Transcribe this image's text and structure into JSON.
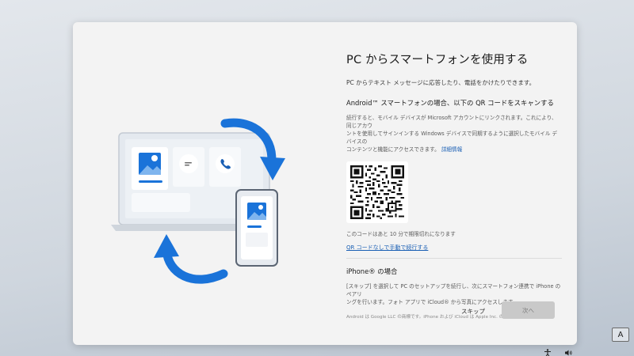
{
  "oobe": {
    "title": "PC からスマートフォンを使用する",
    "subtitle": "PC からテキスト メッセージに応答したり、電話をかけたりできます。",
    "android": {
      "heading": "Android™ スマートフォンの場合、以下の QR コードをスキャンする",
      "desc_line1": "続行すると、モバイル デバイスが Microsoft アカウントにリンクされます。これにより、同じアカウ",
      "desc_line2": "ントを使用してサインインする Windows デバイスで同期するように選択したモバイル デバイスの",
      "desc_line3": "コンテンツと機能にアクセスできます。",
      "details_link": "詳細情報",
      "expire_text": "このコードはあと 10 分で期限切れになります",
      "manual_link": "QR コードなしで手動で続行する"
    },
    "iphone": {
      "heading": "iPhone® の場合",
      "desc_line1": "[スキップ] を選択して PC のセットアップを続行し、次にスマートフォン連携で iPhone のペアリ",
      "desc_line2": "ングを行います。フォト アプリで iCloud® から写真にアクセスします。"
    },
    "footnote": "Android は Google LLC の商標です。iPhone および iCloud は Apple Inc. の商標です。",
    "buttons": {
      "skip": "スキップ",
      "next": "次へ"
    }
  },
  "tray": {
    "language_indicator": "A"
  },
  "colors": {
    "accent": "#1a5fb4",
    "arrow_blue": "#1a73d9",
    "panel_bg": "#f3f3f3",
    "disabled_button": "#c9c9c9"
  },
  "icons": [
    "image-icon",
    "message-icon",
    "phone-icon",
    "sync-arrow-icon",
    "accessibility-icon",
    "volume-icon"
  ]
}
